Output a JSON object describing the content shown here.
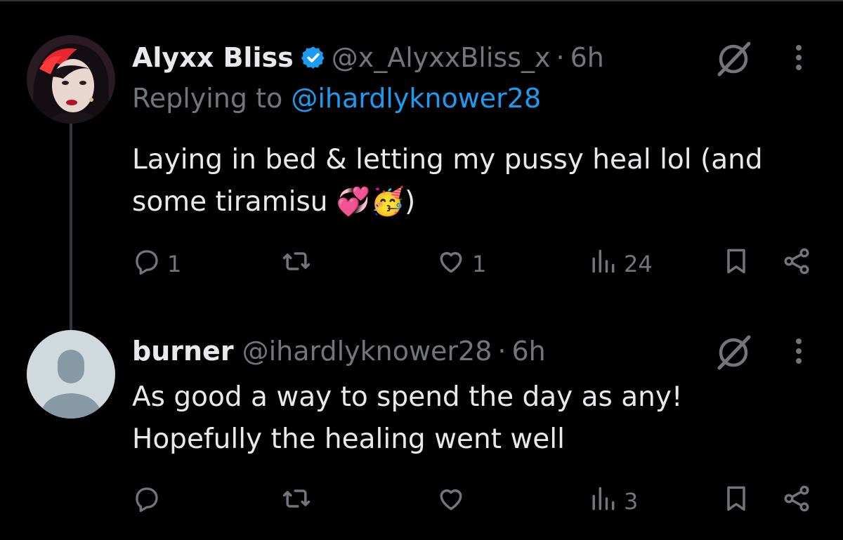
{
  "colors": {
    "background": "#000000",
    "text": "#e7e9ea",
    "muted": "#71767b",
    "link": "#1d9bf0",
    "verified": "#1d9bf0",
    "thread_line": "#333639"
  },
  "tweets": [
    {
      "name": "Alyxx Bliss",
      "verified": true,
      "handle": "@x_AlyxxBliss_x",
      "separator": "·",
      "time": "6h",
      "replying_prefix": "Replying to ",
      "replying_to": "@ihardlyknower28",
      "text_lines": [
        "Laying in bed & letting my pussy heal lol (and",
        "some tiramisu 💞🥳)"
      ],
      "stats": {
        "replies": "1",
        "reposts": "",
        "likes": "1",
        "views": "24"
      },
      "icons": [
        "grok-icon",
        "more-icon",
        "reply-icon",
        "repost-icon",
        "like-icon",
        "views-icon",
        "bookmark-icon",
        "share-icon"
      ]
    },
    {
      "name": "burner",
      "verified": false,
      "handle": "@ihardlyknower28",
      "separator": "·",
      "time": "6h",
      "text_lines": [
        "As good a way to spend the day as any!",
        "Hopefully the healing went well"
      ],
      "stats": {
        "replies": "",
        "reposts": "",
        "likes": "",
        "views": "3"
      },
      "icons": [
        "grok-icon",
        "more-icon",
        "reply-icon",
        "repost-icon",
        "like-icon",
        "views-icon",
        "bookmark-icon",
        "share-icon"
      ]
    }
  ]
}
